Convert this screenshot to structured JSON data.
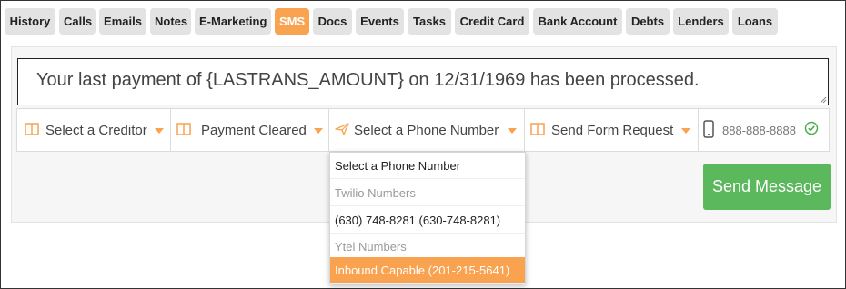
{
  "tabs": [
    {
      "label": "History",
      "active": false
    },
    {
      "label": "Calls",
      "active": false
    },
    {
      "label": "Emails",
      "active": false
    },
    {
      "label": "Notes",
      "active": false
    },
    {
      "label": "E-Marketing",
      "active": false
    },
    {
      "label": "SMS",
      "active": true
    },
    {
      "label": "Docs",
      "active": false
    },
    {
      "label": "Events",
      "active": false
    },
    {
      "label": "Tasks",
      "active": false
    },
    {
      "label": "Credit Card",
      "active": false
    },
    {
      "label": "Bank Account",
      "active": false
    },
    {
      "label": "Debts",
      "active": false
    },
    {
      "label": "Lenders",
      "active": false
    },
    {
      "label": "Loans",
      "active": false
    }
  ],
  "message": {
    "text": "Your last payment of {LASTRANS_AMOUNT} on 12/31/1969 has been processed."
  },
  "toolbar": {
    "creditor": {
      "label": "Select a Creditor",
      "icon": "book-icon"
    },
    "template": {
      "label": "Payment Cleared",
      "icon": "book-icon"
    },
    "phone_number": {
      "label": "Select a Phone Number",
      "icon": "paper-plane-icon"
    },
    "form_request": {
      "label": "Send Form Request",
      "icon": "book-icon"
    },
    "recipient": {
      "label": "888-888-8888",
      "icon": "mobile-phone-icon",
      "status_icon": "check-circle-icon"
    }
  },
  "phone_dropdown": {
    "items": [
      {
        "label": "Select a Phone Number",
        "type": "option"
      },
      {
        "label": "Twilio Numbers",
        "type": "group-header"
      },
      {
        "label": "(630) 748-8281 (630-748-8281)",
        "type": "option"
      },
      {
        "label": "Ytel Numbers",
        "type": "group-header"
      },
      {
        "label": "Inbound Capable (201-215-5641)",
        "type": "option",
        "highlighted": true
      }
    ]
  },
  "send_button": {
    "label": "Send Message"
  },
  "colors": {
    "accent": "#f9a24f",
    "send": "#5cb85c",
    "status_ok": "#4cae4c"
  }
}
